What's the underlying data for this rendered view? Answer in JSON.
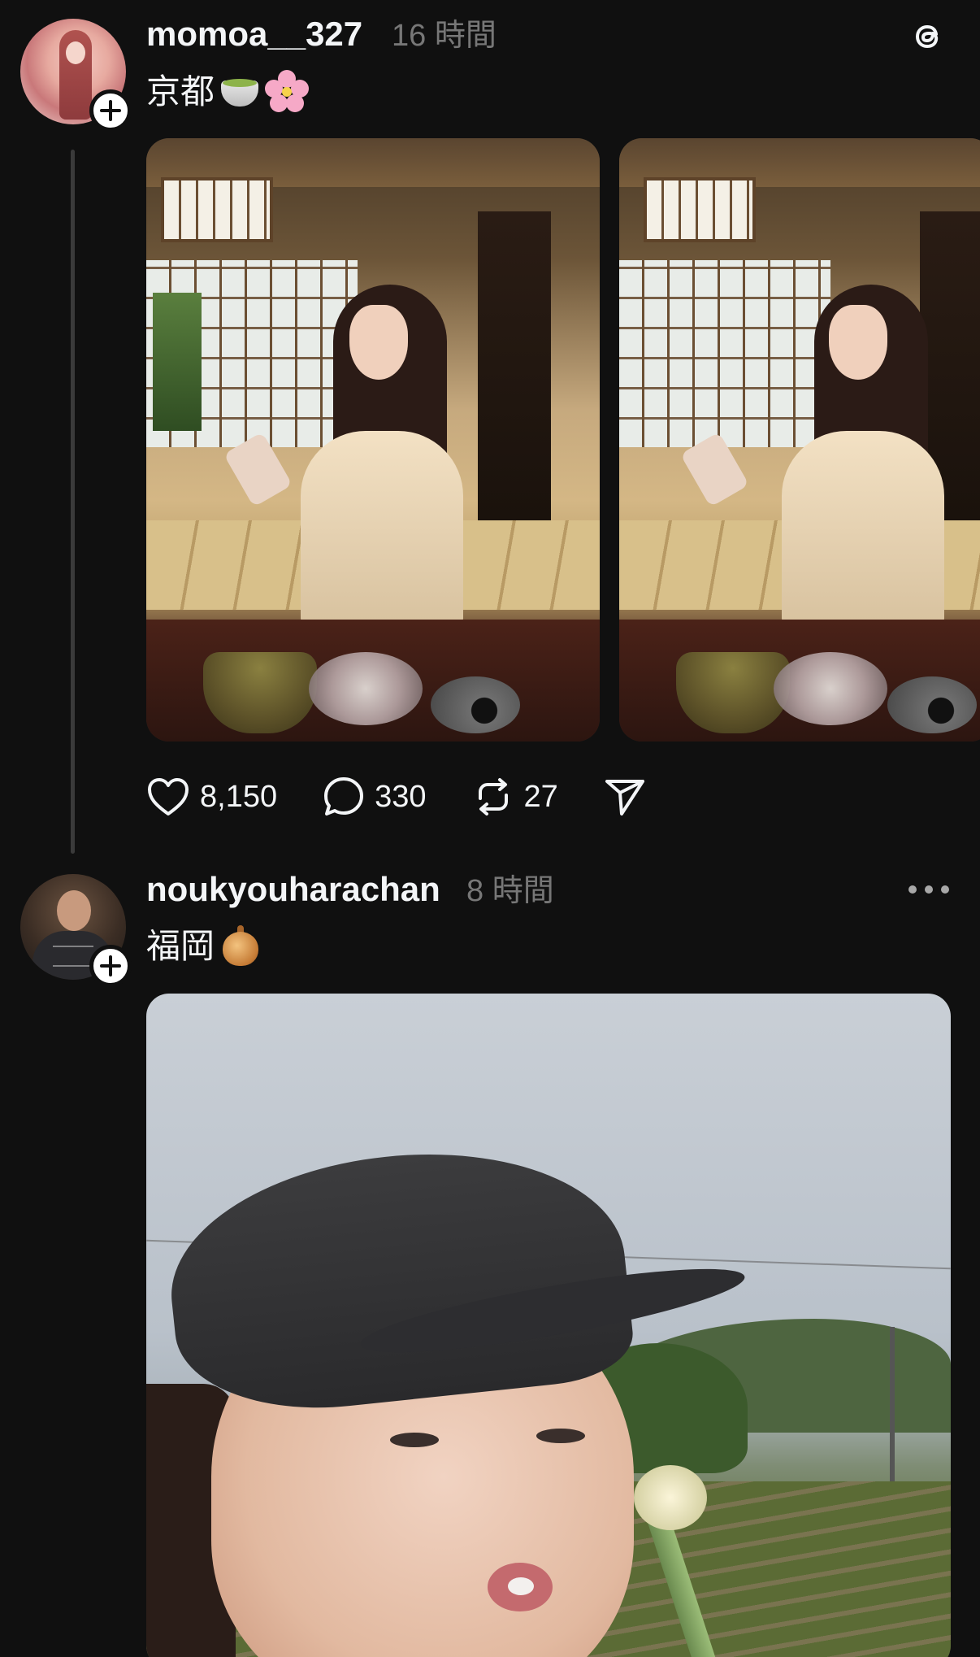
{
  "posts": [
    {
      "username": "momoa__327",
      "time": "16 時間",
      "caption": "京都",
      "caption_emoji": [
        "tea-emoji",
        "cherry-blossom-emoji"
      ],
      "photos": [
        "photo-kyoto-1",
        "photo-kyoto-2"
      ],
      "likes": "8,150",
      "comments": "330",
      "reposts": "27"
    },
    {
      "username": "noukyouharachan",
      "time": "8 時間",
      "caption": "福岡",
      "caption_emoji": [
        "onion-emoji"
      ],
      "photos": [
        "photo-fukuoka-1"
      ]
    }
  ],
  "icons": {
    "logo": "threads-logo-icon",
    "follow": "plus-icon",
    "like": "heart-icon",
    "comment": "comment-icon",
    "repost": "repost-icon",
    "share": "share-icon",
    "more": "more-icon"
  },
  "colors": {
    "background": "#101010",
    "text": "#f3f5f7",
    "muted": "#777777"
  }
}
